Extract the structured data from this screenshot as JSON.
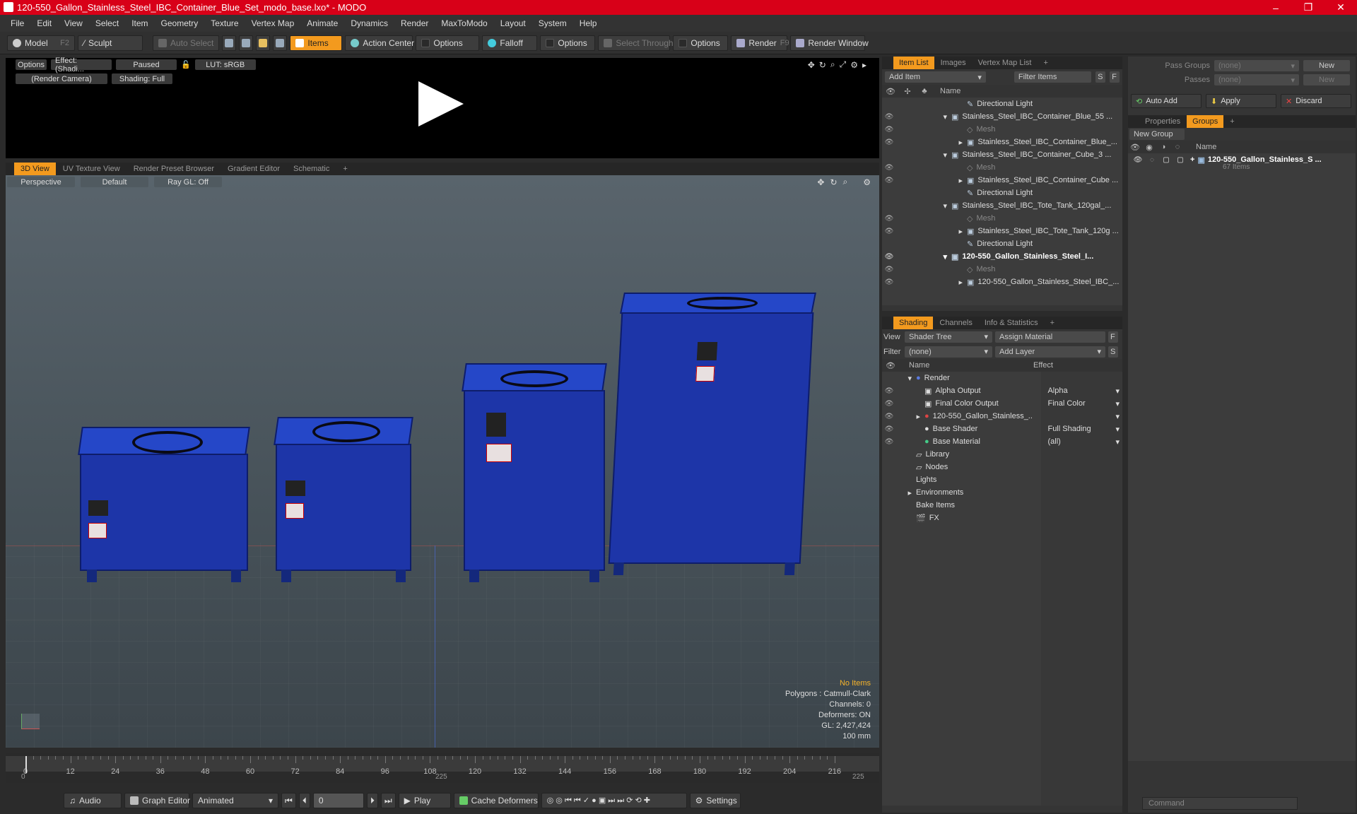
{
  "window": {
    "title": "120-550_Gallon_Stainless_Steel_IBC_Container_Blue_Set_modo_base.lxo* - MODO",
    "minimize": "–",
    "maximize": "❐",
    "close": "✕"
  },
  "menu": [
    "File",
    "Edit",
    "View",
    "Select",
    "Item",
    "Geometry",
    "Texture",
    "Vertex Map",
    "Animate",
    "Dynamics",
    "Render",
    "MaxToModo",
    "Layout",
    "System",
    "Help"
  ],
  "toolbar": {
    "model": "Model",
    "model_key": "F2",
    "sculpt": "Sculpt",
    "auto_select": "Auto Select",
    "items": "Items",
    "action_center": "Action Center",
    "options1": "Options",
    "falloff": "Falloff",
    "options2": "Options",
    "select_through": "Select Through",
    "options3": "Options",
    "render": "Render",
    "render_key": "F9",
    "render_window": "Render Window"
  },
  "preview": {
    "options": "Options",
    "effect": "Effect: (Shadi...",
    "paused": "Paused",
    "lut": "LUT: sRGB",
    "camera": "(Render Camera)",
    "shading": "Shading: Full"
  },
  "viewport_tabs": [
    "3D View",
    "UV Texture View",
    "Render Preset Browser",
    "Gradient Editor",
    "Schematic",
    "+"
  ],
  "viewport": {
    "perspective": "Perspective",
    "default": "Default",
    "raygl": "Ray GL: Off"
  },
  "stats": {
    "no_items": "No Items",
    "polygons": "Polygons : Catmull-Clark",
    "channels": "Channels: 0",
    "deformers": "Deformers: ON",
    "gl": "GL: 2,427,424",
    "unit": "100 mm"
  },
  "timeline": {
    "ticks": [
      "0",
      "12",
      "24",
      "36",
      "48",
      "60",
      "72",
      "84",
      "96",
      "108",
      "120",
      "132",
      "144",
      "156",
      "168",
      "180",
      "192",
      "204",
      "216"
    ],
    "start": "0",
    "mid": "225",
    "end": "225"
  },
  "bottom": {
    "audio": "Audio",
    "graph_editor": "Graph Editor",
    "animated": "Animated",
    "frame": "0",
    "play": "Play",
    "cache_deformers": "Cache Deformers",
    "settings": "Settings"
  },
  "item_list": {
    "tabs": [
      "Item List",
      "Images",
      "Vertex Map List",
      "+"
    ],
    "add_item": "Add Item",
    "filter_items": "Filter Items",
    "s": "S",
    "f": "F",
    "name_col": "Name",
    "rows": [
      {
        "label": "Directional Light",
        "indent": 1
      },
      {
        "label": "Stainless_Steel_IBC_Container_Blue_55 ...",
        "indent": 0
      },
      {
        "label": "Mesh",
        "indent": 1,
        "dim": true
      },
      {
        "label": "Stainless_Steel_IBC_Container_Blue_...",
        "indent": 1
      },
      {
        "label": "Stainless_Steel_IBC_Container_Cube_3 ...",
        "indent": 0
      },
      {
        "label": "Mesh",
        "indent": 1,
        "dim": true
      },
      {
        "label": "Stainless_Steel_IBC_Container_Cube ...",
        "indent": 1
      },
      {
        "label": "Directional Light",
        "indent": 1
      },
      {
        "label": "Stainless_Steel_IBC_Tote_Tank_120gal_...",
        "indent": 0
      },
      {
        "label": "Mesh",
        "indent": 1,
        "dim": true
      },
      {
        "label": "Stainless_Steel_IBC_Tote_Tank_120g ...",
        "indent": 1
      },
      {
        "label": "Directional Light",
        "indent": 1
      },
      {
        "label": "120-550_Gallon_Stainless_Steel_I...",
        "indent": 0,
        "bold": true
      },
      {
        "label": "Mesh",
        "indent": 1,
        "dim": true
      },
      {
        "label": "120-550_Gallon_Stainless_Steel_IBC_...",
        "indent": 1
      }
    ]
  },
  "shading": {
    "tabs": [
      "Shading",
      "Channels",
      "Info & Statistics",
      "+"
    ],
    "view_label": "View",
    "view_value": "Shader Tree",
    "assign_material": "Assign Material",
    "f": "F",
    "filter_label": "Filter",
    "filter_value": "(none)",
    "add_layer": "Add Layer",
    "s": "S",
    "name_col": "Name",
    "effect_col": "Effect",
    "rows": [
      {
        "label": "Render",
        "effect": "",
        "indent": 0
      },
      {
        "label": "Alpha Output",
        "effect": "Alpha",
        "indent": 1
      },
      {
        "label": "Final Color Output",
        "effect": "Final Color",
        "indent": 1
      },
      {
        "label": "120-550_Gallon_Stainless_...",
        "effect": "",
        "indent": 1
      },
      {
        "label": "Base Shader",
        "effect": "Full Shading",
        "indent": 1
      },
      {
        "label": "Base Material",
        "effect": "(all)",
        "indent": 1
      },
      {
        "label": "Library",
        "effect": "",
        "indent": 0
      },
      {
        "label": "Nodes",
        "effect": "",
        "indent": 0
      },
      {
        "label": "Lights",
        "effect": "",
        "indent": 0
      },
      {
        "label": "Environments",
        "effect": "",
        "indent": 0
      },
      {
        "label": "Bake Items",
        "effect": "",
        "indent": 0
      },
      {
        "label": "FX",
        "effect": "",
        "indent": 0
      }
    ]
  },
  "right": {
    "pass_groups": "Pass Groups",
    "pass_groups_val": "(none)",
    "new": "New",
    "passes": "Passes",
    "passes_val": "(none)",
    "new2": "New",
    "auto_add": "Auto Add",
    "apply": "Apply",
    "discard": "Discard",
    "tabs": [
      "Properties",
      "Groups",
      "+"
    ],
    "new_group": "New Group",
    "name_col": "Name",
    "group_name": "120-550_Gallon_Stainless_S ...",
    "group_count": "67 Items",
    "command": "Command"
  }
}
